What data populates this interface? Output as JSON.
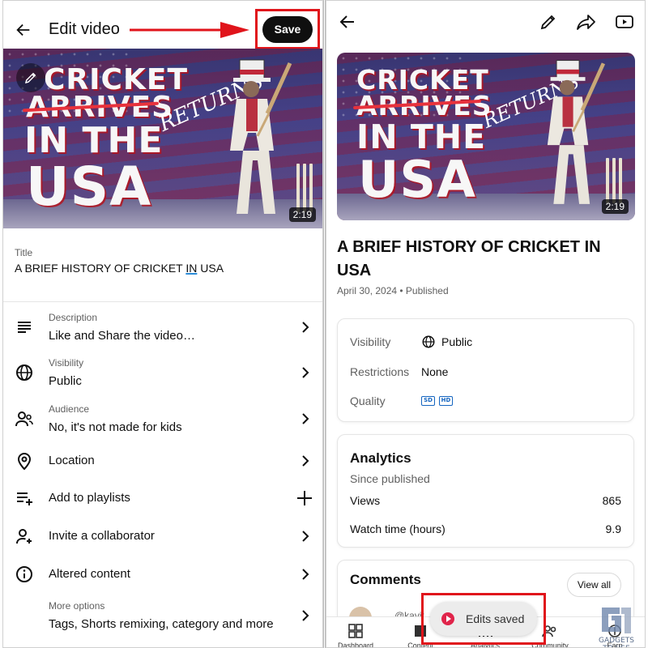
{
  "colors": {
    "accent_red": "#e0141b",
    "text_primary": "#0f0f0f",
    "text_secondary": "#606060",
    "hd_badge_blue": "#1565c0"
  },
  "left": {
    "header": {
      "back_icon": "arrow-left-icon",
      "title": "Edit video",
      "save_label": "Save"
    },
    "thumbnail": {
      "line1": "CRICKET",
      "line2": "ARRIVES",
      "line2_overlay": "RETURNS",
      "line3": "IN THE",
      "line4": "USA",
      "duration": "2:19",
      "edit_icon": "pencil-icon"
    },
    "title_field": {
      "label": "Title",
      "value_before": "A BRIEF HISTORY OF CRICKET ",
      "value_underlined": "IN",
      "value_after": " USA"
    },
    "rows": [
      {
        "icon": "description-icon",
        "label": "Description",
        "value": "Like and Share the video…",
        "action": "chevron-right-icon"
      },
      {
        "icon": "globe-icon",
        "label": "Visibility",
        "value": "Public",
        "action": "chevron-right-icon"
      },
      {
        "icon": "audience-icon",
        "label": "Audience",
        "value": "No, it's not made for kids",
        "action": "chevron-right-icon"
      },
      {
        "icon": "location-pin-icon",
        "label": "",
        "value": "Location",
        "action": "chevron-right-icon"
      },
      {
        "icon": "playlist-add-icon",
        "label": "",
        "value": "Add to playlists",
        "action": "plus-icon"
      },
      {
        "icon": "person-add-icon",
        "label": "",
        "value": "Invite a collaborator",
        "action": "chevron-right-icon"
      },
      {
        "icon": "info-icon",
        "label": "",
        "value": "Altered content",
        "action": "chevron-right-icon"
      },
      {
        "icon": "",
        "label": "More options",
        "value": "Tags, Shorts remixing, category and more",
        "action": "chevron-right-icon"
      }
    ]
  },
  "right": {
    "header": {
      "back_icon": "arrow-left-icon",
      "edit_icon": "pencil-icon",
      "share_icon": "share-icon",
      "youtube_icon": "youtube-icon"
    },
    "thumbnail": {
      "duration": "2:19"
    },
    "video_title": "A BRIEF HISTORY OF CRICKET IN USA",
    "date_status": "April 30, 2024 • Published",
    "details": {
      "visibility_label": "Visibility",
      "visibility_value": "Public",
      "restrictions_label": "Restrictions",
      "restrictions_value": "None",
      "quality_label": "Quality",
      "quality_badges": [
        "SD",
        "HD"
      ]
    },
    "analytics": {
      "heading": "Analytics",
      "subheading": "Since published",
      "rows": [
        {
          "label": "Views",
          "value": "865"
        },
        {
          "label": "Watch time (hours)",
          "value": "9.9"
        }
      ]
    },
    "comments": {
      "heading": "Comments",
      "view_all": "View all",
      "handle": "@kavit"
    },
    "toast": {
      "text": "Edits saved",
      "icon": "youtube-studio-icon"
    },
    "bottom_nav": [
      {
        "icon": "dashboard-icon",
        "label": "Dashboard"
      },
      {
        "icon": "content-icon",
        "label": "Content"
      },
      {
        "icon": "analytics-icon",
        "label": "Analytics"
      },
      {
        "icon": "community-icon",
        "label": "Community"
      },
      {
        "icon": "earn-icon",
        "label": "Earn"
      }
    ],
    "watermark": "GADGETS TO USE"
  }
}
